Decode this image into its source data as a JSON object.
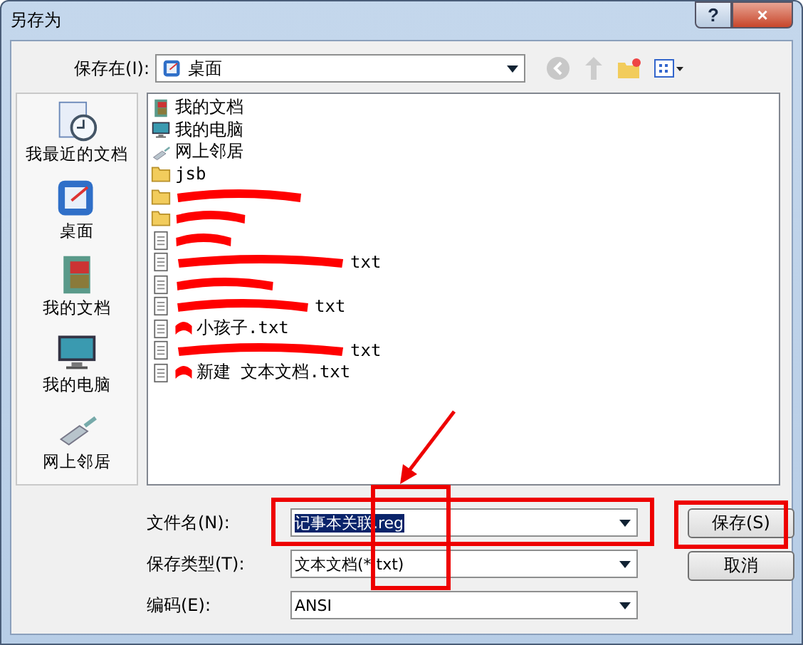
{
  "window": {
    "title": "另存为",
    "buttons": [
      "?",
      "×"
    ]
  },
  "location": {
    "label": "保存在(I):",
    "value": "桌面"
  },
  "places": [
    {
      "label": "我最近的文档",
      "kind": "recent"
    },
    {
      "label": "桌面",
      "kind": "desktop"
    },
    {
      "label": "我的文档",
      "kind": "documents"
    },
    {
      "label": "我的电脑",
      "kind": "computer"
    },
    {
      "label": "网上邻居",
      "kind": "network"
    }
  ],
  "files": [
    {
      "name": "我的文档",
      "kind": "documents",
      "redacted": false
    },
    {
      "name": "我的电脑",
      "kind": "computer",
      "redacted": false
    },
    {
      "name": "网上邻居",
      "kind": "network",
      "redacted": false
    },
    {
      "name": "jsb",
      "kind": "folder",
      "redacted": false
    },
    {
      "kind": "folder",
      "redacted": true
    },
    {
      "kind": "folder",
      "redacted": true
    },
    {
      "kind": "text",
      "redacted": true
    },
    {
      "name": "txt",
      "kind": "text",
      "redacted": true
    },
    {
      "kind": "text",
      "redacted": true
    },
    {
      "name": "txt",
      "kind": "text",
      "redacted": true
    },
    {
      "name": "小孩子.txt",
      "kind": "text",
      "redacted": true
    },
    {
      "name": "txt",
      "kind": "text",
      "redacted": true
    },
    {
      "name": "新建 文本文档.txt",
      "kind": "text",
      "redacted": true
    }
  ],
  "fields": [
    {
      "label": "文件名(N):",
      "value": "记事本关联.reg",
      "selected": true
    },
    {
      "label": "保存类型(T):",
      "value": "文本文档(*.txt)",
      "selected": false
    },
    {
      "label": "编码(E):",
      "value": "ANSI",
      "selected": false
    }
  ],
  "buttons": [
    "保存(S)",
    "取消"
  ],
  "annotations": [
    {
      "kind": "arrow"
    },
    {
      "kind": "box"
    },
    {
      "kind": "box"
    },
    {
      "kind": "box"
    }
  ]
}
